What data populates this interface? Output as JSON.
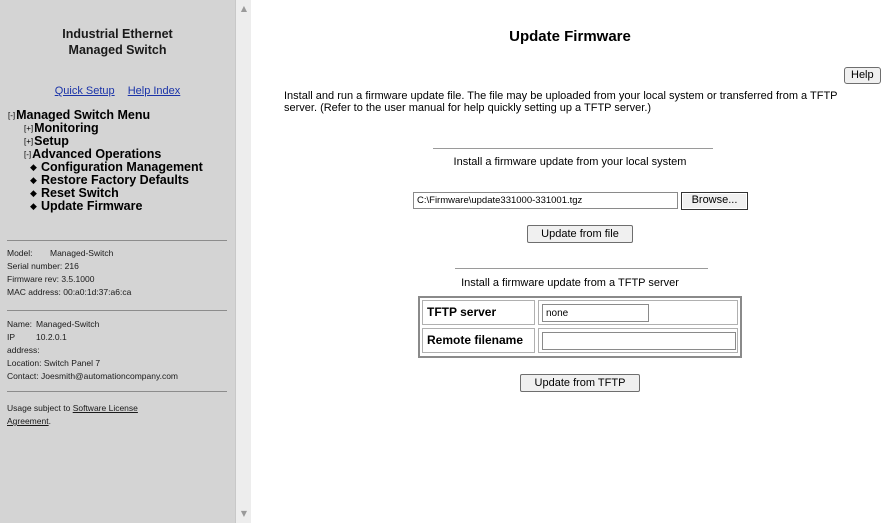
{
  "sidebar": {
    "title_line1": "Industrial Ethernet",
    "title_line2": "Managed Switch",
    "links": {
      "quick_setup": "Quick Setup",
      "help_index": "Help Index"
    },
    "menu": {
      "root": {
        "toggle": "[-]",
        "label": "Managed Switch Menu"
      },
      "monitoring": {
        "toggle": "[+]",
        "label": "Monitoring"
      },
      "setup": {
        "toggle": "[+]",
        "label": "Setup"
      },
      "advanced": {
        "toggle": "[-]",
        "label": "Advanced Operations"
      },
      "items": [
        "Configuration Management",
        "Restore Factory Defaults",
        "Reset Switch",
        "Update Firmware"
      ]
    },
    "device": {
      "model_label": "Model:",
      "model_value": "Managed-Switch",
      "serial_label": "Serial number:",
      "serial_value": "216",
      "firmware_label": "Firmware rev:",
      "firmware_value": "3.5.1000",
      "mac_label": "MAC address:",
      "mac_value": "00:a0:1d:37:a6:ca"
    },
    "network": {
      "name_label": "Name:",
      "name_value": "Managed-Switch",
      "ip_label": "IP",
      "ip_value": "10.2.0.1",
      "ip_label2": "address:",
      "location_label": "Location:",
      "location_value": "Switch Panel 7",
      "contact_label": "Contact:",
      "contact_value": "Joesmith@automationcompany.com"
    },
    "license": {
      "prefix": "Usage subject to ",
      "link_line1": "Software License",
      "link_line2": "Agreement",
      "suffix": "."
    }
  },
  "main": {
    "title": "Update Firmware",
    "help_label": "Help",
    "description": "Install and run a firmware update file. The file may be uploaded from your local system or transferred from a TFTP server. (Refer to the user manual for help quickly setting up a TFTP server.)",
    "local": {
      "heading": "Install a firmware update from your local system",
      "file_path": "C:\\Firmware\\update331000-331001.tgz",
      "browse_label": "Browse...",
      "update_label": "Update from file"
    },
    "tftp": {
      "heading": "Install a firmware update from a TFTP server",
      "server_label": "TFTP server",
      "server_value": "none",
      "filename_label": "Remote filename",
      "filename_value": "",
      "update_label": "Update from TFTP"
    }
  }
}
